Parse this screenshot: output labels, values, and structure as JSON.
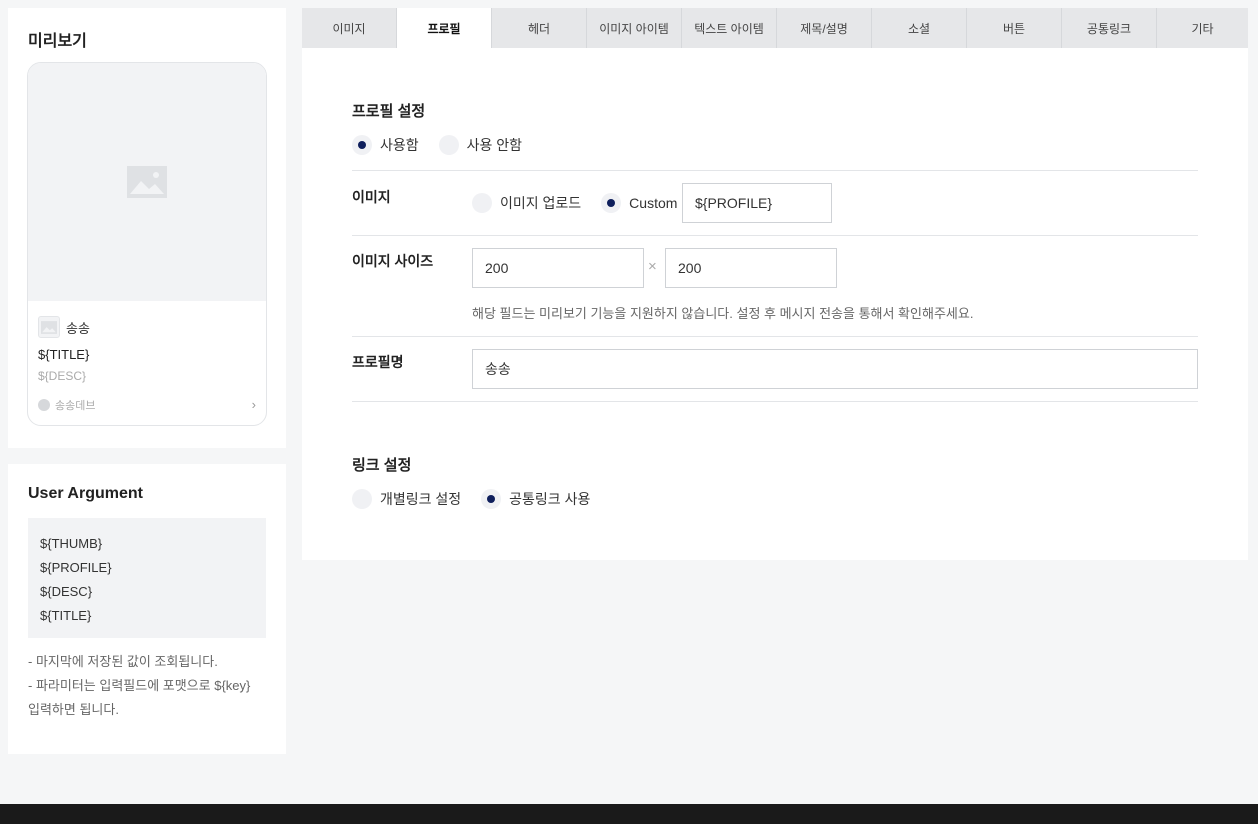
{
  "preview": {
    "title": "미리보기",
    "card": {
      "profile_name": "송송",
      "title": "${TITLE}",
      "desc": "${DESC}",
      "footer_label": "송송데브"
    }
  },
  "user_argument": {
    "title": "User Argument",
    "args": [
      "${THUMB}",
      "${PROFILE}",
      "${DESC}",
      "${TITLE}"
    ],
    "notes": [
      "- 마지막에 저장된 값이 조회됩니다.",
      "- 파라미터는 입력필드에 포맷으로 ${key}",
      "입력하면 됩니다."
    ]
  },
  "tabs": [
    "이미지",
    "프로필",
    "헤더",
    "이미지 아이템",
    "텍스트 아이템",
    "제목/설명",
    "소셜",
    "버튼",
    "공통링크",
    "기타"
  ],
  "active_tab": "프로필",
  "profile_settings": {
    "title": "프로필 설정",
    "use_label": "사용함",
    "not_use_label": "사용 안함",
    "selected": "use",
    "image": {
      "label": "이미지",
      "upload_label": "이미지 업로드",
      "custom_label": "Custom",
      "selected": "custom",
      "custom_value": "${PROFILE}"
    },
    "image_size": {
      "label": "이미지 사이즈",
      "width": "200",
      "height": "200",
      "times": "×",
      "help": "해당 필드는 미리보기 기능을 지원하지 않습니다. 설정 후 메시지 전송을 통해서 확인해주세요."
    },
    "profile_name": {
      "label": "프로필명",
      "value": "송송"
    }
  },
  "link_settings": {
    "title": "링크 설정",
    "individual_label": "개별링크 설정",
    "common_label": "공통링크 사용",
    "selected": "common"
  },
  "colors": {
    "accent": "#0f1f5c",
    "background": "#f5f6f7",
    "tab_inactive": "#e6e7e9",
    "footer": "#1a1a1a"
  }
}
